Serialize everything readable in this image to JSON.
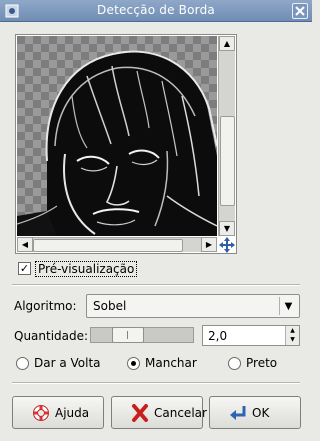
{
  "window": {
    "title": "Detecção de Borda"
  },
  "preview": {
    "toggle_label": "Pré-visualização",
    "checked": true
  },
  "algorithm": {
    "label": "Algoritmo:",
    "value": "Sobel"
  },
  "amount": {
    "label": "Quantidade:",
    "value": "2,0",
    "level": 0.3
  },
  "wrap_mode": {
    "options": [
      {
        "label": "Dar a Volta",
        "selected": false
      },
      {
        "label": "Manchar",
        "selected": true
      },
      {
        "label": "Preto",
        "selected": false
      }
    ]
  },
  "buttons": {
    "help": "Ajuda",
    "cancel": "Cancelar",
    "ok": "OK"
  },
  "icons": {
    "window": "app-icon",
    "close": "close-icon",
    "navigate": "move-cross-icon",
    "help": "lifebuoy-icon",
    "cancel": "red-x-icon",
    "ok": "enter-arrow-icon"
  }
}
